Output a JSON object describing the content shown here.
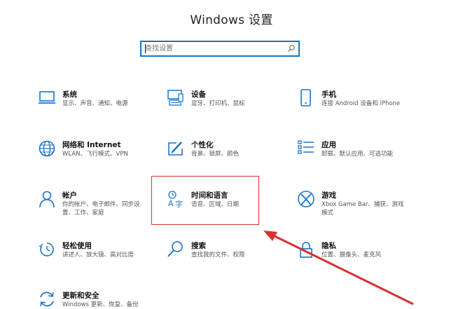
{
  "window": {
    "title": "Windows 设置"
  },
  "search": {
    "placeholder": "查找设置"
  },
  "colors": {
    "accent": "#1a73c8",
    "annotation": "#d93030"
  },
  "tiles": [
    {
      "name": "系统",
      "desc": [
        "显示、声音、通知、电源"
      ],
      "icon": "laptop-icon"
    },
    {
      "name": "设备",
      "desc": [
        "蓝牙、打印机、鼠标"
      ],
      "icon": "devices-icon"
    },
    {
      "name": "手机",
      "desc": [
        "连接 Android 设备和 iPhone"
      ],
      "icon": "phone-icon"
    },
    {
      "name": "网络和 Internet",
      "desc": [
        "WLAN、飞行模式、VPN"
      ],
      "icon": "globe-icon"
    },
    {
      "name": "个性化",
      "desc": [
        "背景、锁屏、颜色"
      ],
      "icon": "personalization-icon"
    },
    {
      "name": "应用",
      "desc": [
        "卸载、默认应用、可选功能"
      ],
      "icon": "apps-icon"
    },
    {
      "name": "帐户",
      "desc": [
        "你的帐户、电子邮件、同步设",
        "置、工作、家庭"
      ],
      "icon": "account-icon"
    },
    {
      "name": "时间和语言",
      "desc": [
        "语音、区域、日期"
      ],
      "icon": "time-language-icon"
    },
    {
      "name": "游戏",
      "desc": [
        "Xbox Game Bar、捕获、游戏",
        "模式"
      ],
      "icon": "xbox-icon"
    },
    {
      "name": "轻松使用",
      "desc": [
        "讲述人、放大镜、高对比度"
      ],
      "icon": "ease-of-access-icon"
    },
    {
      "name": "搜索",
      "desc": [
        "查找我的文件、权限"
      ],
      "icon": "search-icon"
    },
    {
      "name": "隐私",
      "desc": [
        "位置、摄像头、麦克风"
      ],
      "icon": "lock-icon"
    },
    {
      "name": "更新和安全",
      "desc": [
        "Windows 更新、恢复、备份"
      ],
      "icon": "update-icon"
    }
  ]
}
